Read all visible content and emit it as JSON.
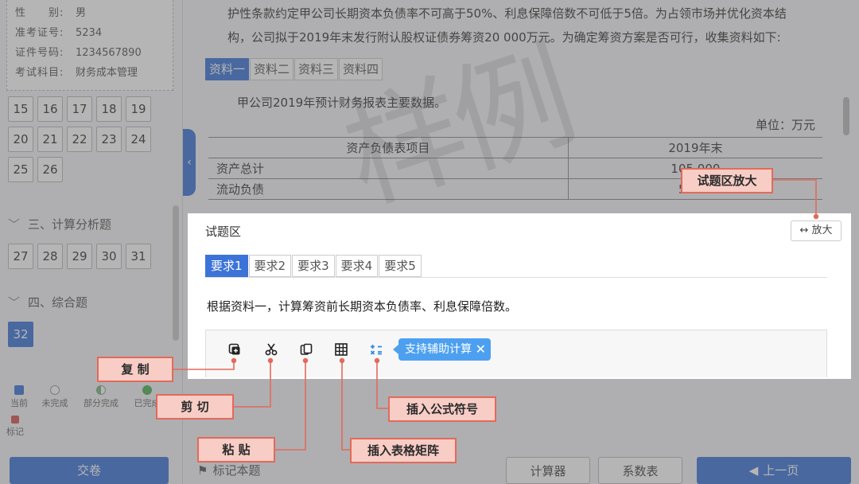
{
  "candidate": {
    "gender_label": "性　　别:",
    "gender": "男",
    "exam_id_label": "准考证号:",
    "exam_id": "5234",
    "id_card_label": "证件号码:",
    "id_card": "1234567890",
    "subject_label": "考试科目:",
    "subject": "财务成本管理"
  },
  "questions": {
    "group_a": [
      "15",
      "16",
      "17",
      "18",
      "19",
      "20",
      "21",
      "22",
      "23",
      "24",
      "25",
      "26"
    ],
    "section3_title": "三、计算分析题",
    "group_b": [
      "27",
      "28",
      "29",
      "30",
      "31"
    ],
    "section4_title": "四、综合题",
    "group_c": [
      "32"
    ]
  },
  "legend": {
    "current": "当前",
    "not_done": "未完成",
    "partial": "部分完成",
    "done": "已完成",
    "mark": "标记"
  },
  "colors": {
    "accent": "#3b73d8",
    "chip": "#4da0f0",
    "callout_fill": "#f7cdc6",
    "callout_border": "#e26a5b"
  },
  "material": {
    "intro_line1": "护性条款约定甲公司长期资本负债率不可高于50%、利息保障倍数不可低于5倍。为占领市场并优化资本结",
    "intro_line2": "构，公司拟于2019年末发行附认股权证债券筹资20 000万元。为确定筹资方案是否可行，收集资料如下:",
    "tabs": [
      "资料一",
      "资料二",
      "资料三",
      "资料四"
    ],
    "caption": "甲公司2019年预计财务报表主要数据。",
    "unit": "单位：万元",
    "table": [
      [
        "资产负债表项目",
        "2019年末"
      ],
      [
        "资产总计",
        "105 000"
      ],
      [
        "流动负债",
        "5 000"
      ]
    ]
  },
  "panel": {
    "title": "试题区",
    "enlarge_icon": "↔",
    "enlarge": "放大",
    "tabs": [
      "要求1",
      "要求2",
      "要求3",
      "要求4",
      "要求5"
    ],
    "requirement": "根据资料一，计算筹资前长期资本负债率、利息保障倍数。",
    "toolbar": {
      "icons": [
        "copy-icon",
        "scissors-icon",
        "paste-icon",
        "table-grid-icon",
        "formula-icon"
      ],
      "chip": "支持辅助计算",
      "chip_close": "✕"
    }
  },
  "callouts": {
    "enlarge": "试题区放大",
    "copy": "复 制",
    "cut": "剪 切",
    "paste": "粘 贴",
    "formula": "插入公式符号",
    "table": "插入表格矩阵"
  },
  "watermark": "样例",
  "bottom": {
    "submit": "交卷",
    "mark_question": "标记本题",
    "calculator": "计算器",
    "coefficient": "系数表",
    "prev": "上一页"
  }
}
